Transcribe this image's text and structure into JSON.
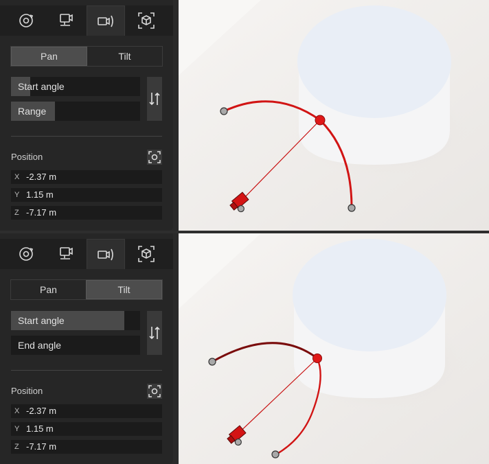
{
  "panels": [
    {
      "tabs": [
        {
          "icon": "orbit-rotate-icon"
        },
        {
          "icon": "camera-mount-icon"
        },
        {
          "icon": "camera-pan-tilt-icon",
          "active": true
        },
        {
          "icon": "3d-box-focus-icon"
        }
      ],
      "mode": {
        "pan_label": "Pan",
        "tilt_label": "Tilt",
        "active": "Pan"
      },
      "sliders": [
        {
          "label": "Start angle",
          "level": 0.15
        },
        {
          "label": "Range",
          "level": 0.34
        }
      ],
      "swap_icon": "swap-arrows-icon",
      "position": {
        "label": "Position",
        "x_axis": "X",
        "x": "-2.37 m",
        "y_axis": "Y",
        "y": "1.15 m",
        "z_axis": "Z",
        "z": "-7.17 m"
      }
    },
    {
      "tabs": [
        {
          "icon": "orbit-rotate-icon"
        },
        {
          "icon": "camera-mount-icon"
        },
        {
          "icon": "camera-pan-tilt-icon",
          "active": true
        },
        {
          "icon": "3d-box-focus-icon"
        }
      ],
      "mode": {
        "pan_label": "Pan",
        "tilt_label": "Tilt",
        "active": "Tilt"
      },
      "sliders": [
        {
          "label": "Start angle",
          "level": 0.88
        },
        {
          "label": "End angle",
          "level": 0.0
        }
      ],
      "swap_icon": "swap-arrows-icon",
      "position": {
        "label": "Position",
        "x_axis": "X",
        "x": "-2.37 m",
        "y_axis": "Y",
        "y": "1.15 m",
        "z_axis": "Z",
        "z": "-7.17 m"
      }
    }
  ],
  "colors": {
    "arc": "#d11414",
    "arc_dark": "#7a0c0c",
    "handle": "#9a9a9a",
    "panel_bg": "#262626"
  }
}
